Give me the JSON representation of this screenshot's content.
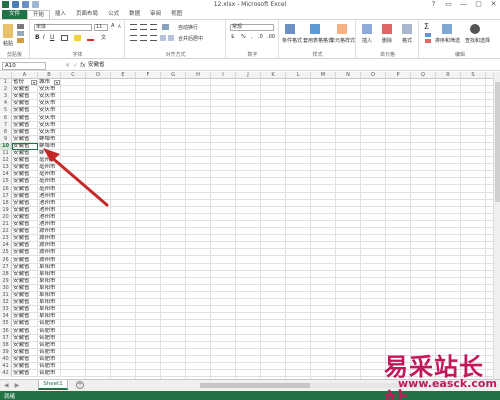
{
  "window": {
    "title": "12.xlsx - Microsoft Excel",
    "controls": [
      "?",
      "▭",
      "—",
      "▢",
      "✕"
    ]
  },
  "tabs": [
    "文件",
    "开始",
    "插入",
    "页面布局",
    "公式",
    "数据",
    "审阅",
    "视图"
  ],
  "ribbon": {
    "font_name": "宋体",
    "font_size": "11",
    "number_format": "常规",
    "groups": [
      "剪贴板",
      "字体",
      "对齐方式",
      "数字",
      "样式",
      "单元格",
      "编辑"
    ],
    "wrap_label": "自动换行",
    "merge_label": "合并后居中",
    "styles": [
      "条件格式",
      "套用表格格式",
      "单元格样式"
    ],
    "cells": [
      "插入",
      "删除",
      "格式"
    ],
    "editing": [
      "排序和筛选",
      "查找和选择"
    ],
    "paste_label": "粘贴"
  },
  "formula_bar": {
    "name_box": "A10",
    "fx": "fx",
    "value": "安徽省"
  },
  "columns": [
    "A",
    "B",
    "C",
    "D",
    "E",
    "F",
    "G",
    "H",
    "I",
    "J",
    "K",
    "L",
    "M",
    "N",
    "O",
    "P",
    "Q",
    "R",
    "S"
  ],
  "sheet": {
    "header_row": [
      "省份",
      "城市"
    ],
    "rows": [
      [
        "安徽省",
        "安庆市"
      ],
      [
        "安徽省",
        "安庆市"
      ],
      [
        "安徽省",
        "安庆市"
      ],
      [
        "安徽省",
        "安庆市"
      ],
      [
        "安徽省",
        "安庆市"
      ],
      [
        "安徽省",
        "安庆市"
      ],
      [
        "安徽省",
        "安庆市"
      ],
      [
        "安徽省",
        "蚌埠市"
      ],
      [
        "安徽省",
        "蚌埠市"
      ],
      [
        "安徽省",
        "蚌"
      ],
      [
        "安徽省",
        "亳州市"
      ],
      [
        "安徽省",
        "亳州市"
      ],
      [
        "安徽省",
        "亳州市"
      ],
      [
        "安徽省",
        "亳州市"
      ],
      [
        "安徽省",
        "亳州市"
      ],
      [
        "安徽省",
        "池州市"
      ],
      [
        "安徽省",
        "池州市"
      ],
      [
        "安徽省",
        "池州市"
      ],
      [
        "安徽省",
        "池州市"
      ],
      [
        "安徽省",
        "池州市"
      ],
      [
        "安徽省",
        "滁州市"
      ],
      [
        "安徽省",
        "滁州市"
      ],
      [
        "安徽省",
        "滁州市"
      ],
      [
        "安徽省",
        "滁州市"
      ],
      [
        "安徽省",
        "滁州市"
      ],
      [
        "安徽省",
        "阜阳市"
      ],
      [
        "安徽省",
        "阜阳市"
      ],
      [
        "安徽省",
        "阜阳市"
      ],
      [
        "安徽省",
        "阜阳市"
      ],
      [
        "安徽省",
        "阜阳市"
      ],
      [
        "安徽省",
        "阜阳市"
      ],
      [
        "安徽省",
        "阜阳市"
      ],
      [
        "安徽省",
        "阜阳市"
      ],
      [
        "安徽省",
        "合肥市"
      ],
      [
        "安徽省",
        "合肥市"
      ],
      [
        "安徽省",
        "合肥市"
      ],
      [
        "安徽省",
        "合肥市"
      ],
      [
        "安徽省",
        "合肥市"
      ],
      [
        "安徽省",
        "合肥市"
      ],
      [
        "安徽省",
        "合肥市"
      ],
      [
        "安徽省",
        "合肥市"
      ]
    ],
    "selected_row": 10
  },
  "sheet_tabs": {
    "active": "Sheet1",
    "add": "+"
  },
  "status": {
    "text": "就绪"
  },
  "watermark": {
    "cn": "易采站长站",
    "url": "www.easck.com"
  },
  "colors": {
    "excel_green": "#217346",
    "arrow_red": "#c62828",
    "watermark": "#c2185b"
  }
}
